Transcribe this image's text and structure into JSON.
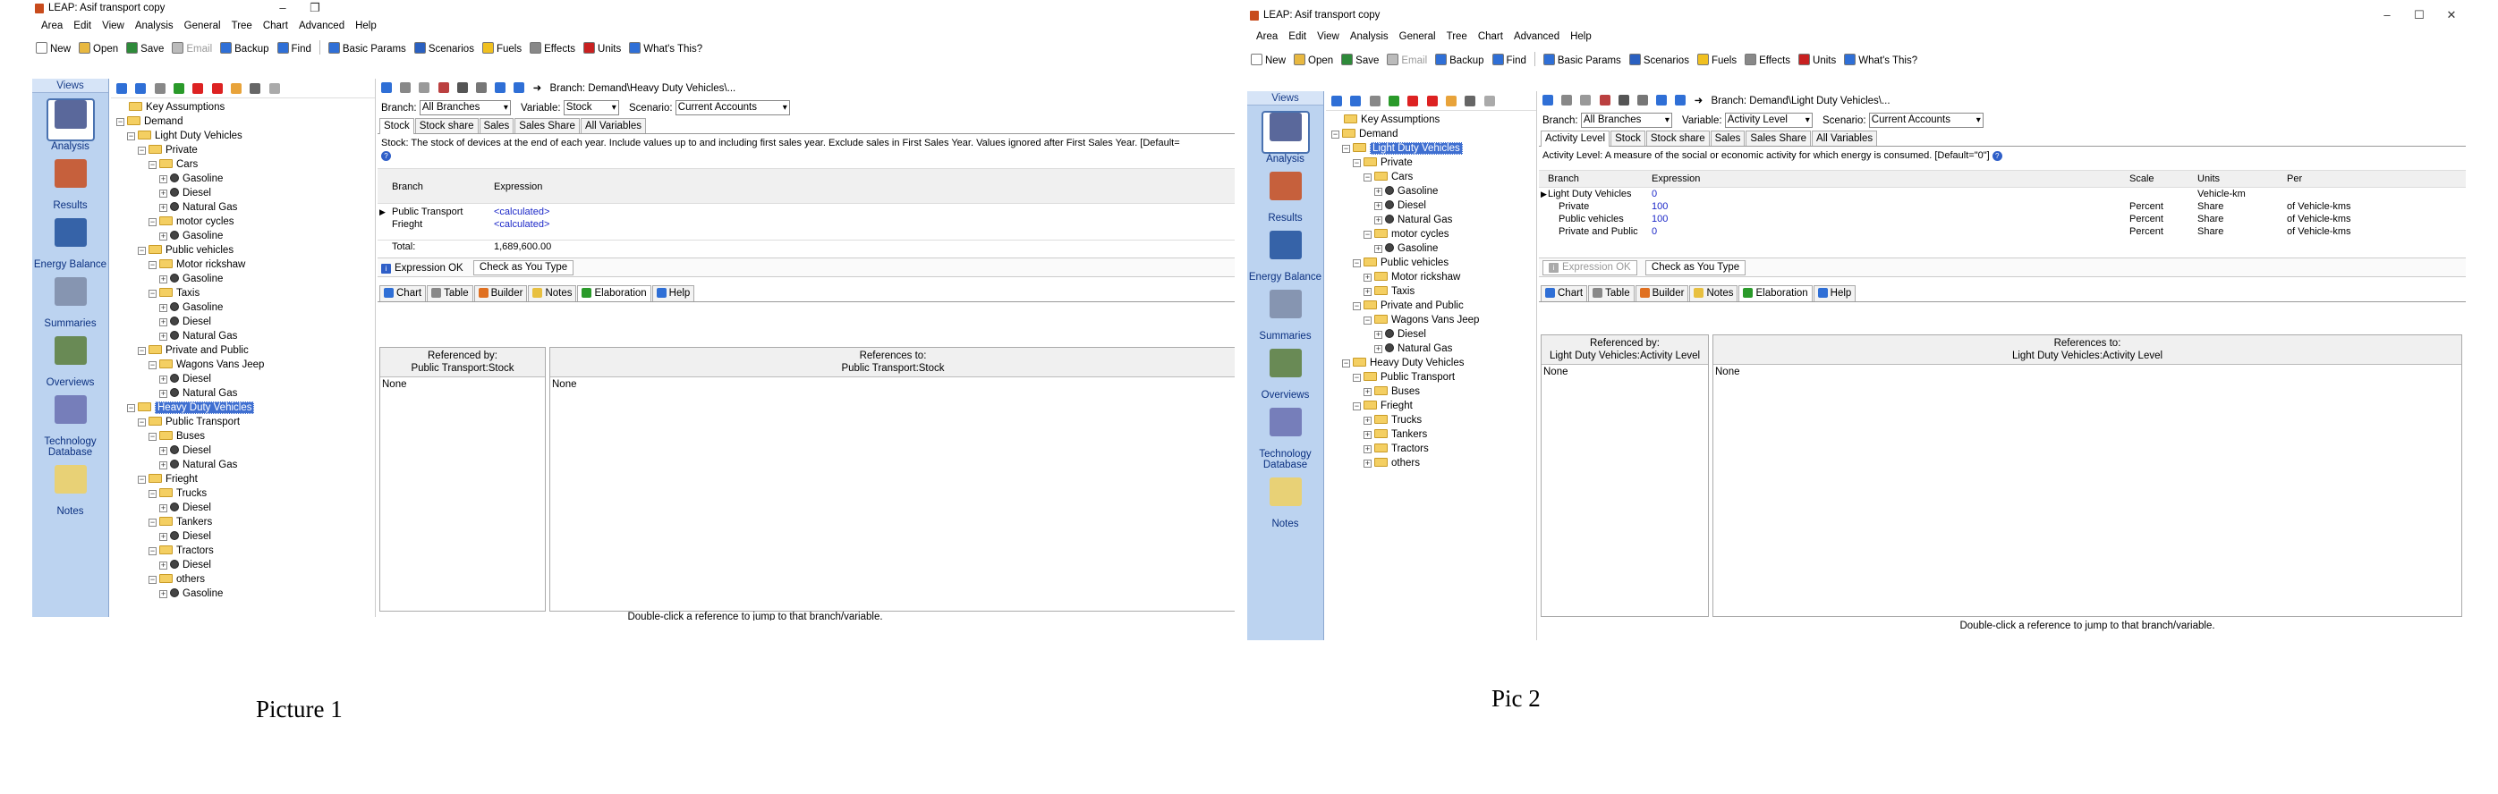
{
  "captions": {
    "left": "Picture 1",
    "right": "Pic 2"
  },
  "window": {
    "title": "LEAP: Asif transport copy",
    "menu": [
      "Area",
      "Edit",
      "View",
      "Analysis",
      "General",
      "Tree",
      "Chart",
      "Advanced",
      "Help"
    ],
    "toolbar": [
      {
        "label": "New",
        "icon": "new-icon"
      },
      {
        "label": "Open",
        "icon": "open-icon"
      },
      {
        "label": "Save",
        "icon": "save-icon"
      },
      {
        "label": "Email",
        "icon": "email-icon",
        "disabled": true
      },
      {
        "label": "Backup",
        "icon": "backup-icon"
      },
      {
        "label": "Find",
        "icon": "find-icon"
      },
      {
        "label": "Basic Params",
        "icon": "params-icon"
      },
      {
        "label": "Scenarios",
        "icon": "scenarios-icon"
      },
      {
        "label": "Fuels",
        "icon": "fuels-icon"
      },
      {
        "label": "Effects",
        "icon": "effects-icon"
      },
      {
        "label": "Units",
        "icon": "units-icon"
      },
      {
        "label": "What's This?",
        "icon": "whats-this-icon"
      }
    ],
    "views": {
      "header": "Views",
      "items": [
        "Analysis",
        "Results",
        "Energy Balance",
        "Summaries",
        "Overviews",
        "Technology Database",
        "Notes"
      ]
    },
    "colors": {
      "selection": "#3f6fd1",
      "views_panel": "#bcd3f0",
      "link": "#1c28c8"
    }
  },
  "shot1": {
    "tree": [
      {
        "label": "Key Assumptions",
        "level": 0,
        "kind": "folder"
      },
      {
        "label": "Demand",
        "level": 0,
        "kind": "folder",
        "exp": "-"
      },
      {
        "label": "Light Duty Vehicles",
        "level": 1,
        "kind": "folder",
        "exp": "-"
      },
      {
        "label": "Private",
        "level": 2,
        "kind": "folder",
        "exp": "-"
      },
      {
        "label": "Cars",
        "level": 3,
        "kind": "folder",
        "exp": "-"
      },
      {
        "label": "Gasoline",
        "level": 4,
        "kind": "fuel",
        "exp": "+"
      },
      {
        "label": "Diesel",
        "level": 4,
        "kind": "fuel",
        "exp": "+"
      },
      {
        "label": "Natural Gas",
        "level": 4,
        "kind": "fuel",
        "exp": "+"
      },
      {
        "label": "motor cycles",
        "level": 3,
        "kind": "folder",
        "exp": "-"
      },
      {
        "label": "Gasoline",
        "level": 4,
        "kind": "fuel",
        "exp": "+"
      },
      {
        "label": "Public vehicles",
        "level": 2,
        "kind": "folder",
        "exp": "-"
      },
      {
        "label": "Motor rickshaw",
        "level": 3,
        "kind": "folder",
        "exp": "-"
      },
      {
        "label": "Gasoline",
        "level": 4,
        "kind": "fuel",
        "exp": "+"
      },
      {
        "label": "Taxis",
        "level": 3,
        "kind": "folder",
        "exp": "-"
      },
      {
        "label": "Gasoline",
        "level": 4,
        "kind": "fuel",
        "exp": "+"
      },
      {
        "label": "Diesel",
        "level": 4,
        "kind": "fuel",
        "exp": "+"
      },
      {
        "label": "Natural Gas",
        "level": 4,
        "kind": "fuel",
        "exp": "+"
      },
      {
        "label": "Private and Public",
        "level": 2,
        "kind": "folder",
        "exp": "-"
      },
      {
        "label": "Wagons Vans Jeep",
        "level": 3,
        "kind": "folder",
        "exp": "-"
      },
      {
        "label": "Diesel",
        "level": 4,
        "kind": "fuel",
        "exp": "+"
      },
      {
        "label": "Natural Gas",
        "level": 4,
        "kind": "fuel",
        "exp": "+"
      },
      {
        "label": "Heavy Duty Vehicles",
        "level": 1,
        "kind": "folder",
        "exp": "-",
        "selected": true
      },
      {
        "label": "Public Transport",
        "level": 2,
        "kind": "folder",
        "exp": "-"
      },
      {
        "label": "Buses",
        "level": 3,
        "kind": "folder",
        "exp": "-"
      },
      {
        "label": "Diesel",
        "level": 4,
        "kind": "fuel",
        "exp": "+"
      },
      {
        "label": "Natural Gas",
        "level": 4,
        "kind": "fuel",
        "exp": "+"
      },
      {
        "label": "Frieght",
        "level": 2,
        "kind": "folder",
        "exp": "-"
      },
      {
        "label": "Trucks",
        "level": 3,
        "kind": "folder",
        "exp": "-"
      },
      {
        "label": "Diesel",
        "level": 4,
        "kind": "fuel",
        "exp": "+"
      },
      {
        "label": "Tankers",
        "level": 3,
        "kind": "folder",
        "exp": "-"
      },
      {
        "label": "Diesel",
        "level": 4,
        "kind": "fuel",
        "exp": "+"
      },
      {
        "label": "Tractors",
        "level": 3,
        "kind": "folder",
        "exp": "-"
      },
      {
        "label": "Diesel",
        "level": 4,
        "kind": "fuel",
        "exp": "+"
      },
      {
        "label": "others",
        "level": 3,
        "kind": "folder",
        "exp": "-"
      },
      {
        "label": "Gasoline",
        "level": 4,
        "kind": "fuel",
        "exp": "+"
      }
    ],
    "breadcrumb": "Branch: Demand\\Heavy Duty Vehicles\\...",
    "branch_label": "Branch:",
    "branch_value": "All Branches",
    "variable_label": "Variable:",
    "variable_value": "Stock",
    "scenario_label": "Scenario:",
    "scenario_value": "Current Accounts",
    "tabs": [
      "Stock",
      "Stock share",
      "Sales",
      "Sales Share",
      "All Variables"
    ],
    "active_tab": 0,
    "description": "Stock: The stock of devices at the end of each year.  Include values up to and including first sales year.  Exclude sales in First Sales Year.  Values ignored after First Sales Year. [Default=",
    "grid_headers": [
      "Branch",
      "Expression"
    ],
    "rows": [
      {
        "branch": "Public Transport",
        "expr": "<calculated>"
      },
      {
        "branch": "Frieght",
        "expr": "<calculated>"
      }
    ],
    "total_label": "Total:",
    "total_value": "1,689,600.00",
    "status_ok": "Expression OK",
    "check_label": "Check as You Type",
    "bottom_tabs": [
      "Chart",
      "Table",
      "Builder",
      "Notes",
      "Elaboration",
      "Help"
    ],
    "active_bottom_tab": 4,
    "ref_by_title": "Referenced by:",
    "ref_by_sub": "Public Transport:Stock",
    "ref_to_title": "References to:",
    "ref_to_sub": "Public Transport:Stock",
    "ref_by_body": "None",
    "ref_to_body": "None",
    "footer": "Double-click a reference to jump to that branch/variable."
  },
  "shot2": {
    "tree": [
      {
        "label": "Key Assumptions",
        "level": 0,
        "kind": "folder"
      },
      {
        "label": "Demand",
        "level": 0,
        "kind": "folder",
        "exp": "-"
      },
      {
        "label": "Light Duty Vehicles",
        "level": 1,
        "kind": "folder",
        "exp": "-",
        "selected": true
      },
      {
        "label": "Private",
        "level": 2,
        "kind": "folder",
        "exp": "-"
      },
      {
        "label": "Cars",
        "level": 3,
        "kind": "folder",
        "exp": "-"
      },
      {
        "label": "Gasoline",
        "level": 4,
        "kind": "fuel",
        "exp": "+"
      },
      {
        "label": "Diesel",
        "level": 4,
        "kind": "fuel",
        "exp": "+"
      },
      {
        "label": "Natural Gas",
        "level": 4,
        "kind": "fuel",
        "exp": "+"
      },
      {
        "label": "motor cycles",
        "level": 3,
        "kind": "folder",
        "exp": "-"
      },
      {
        "label": "Gasoline",
        "level": 4,
        "kind": "fuel",
        "exp": "+"
      },
      {
        "label": "Public vehicles",
        "level": 2,
        "kind": "folder",
        "exp": "-"
      },
      {
        "label": "Motor rickshaw",
        "level": 3,
        "kind": "folder",
        "exp": "+"
      },
      {
        "label": "Taxis",
        "level": 3,
        "kind": "folder",
        "exp": "+"
      },
      {
        "label": "Private and Public",
        "level": 2,
        "kind": "folder",
        "exp": "-"
      },
      {
        "label": "Wagons Vans Jeep",
        "level": 3,
        "kind": "folder",
        "exp": "-"
      },
      {
        "label": "Diesel",
        "level": 4,
        "kind": "fuel",
        "exp": "+"
      },
      {
        "label": "Natural Gas",
        "level": 4,
        "kind": "fuel",
        "exp": "+"
      },
      {
        "label": "Heavy Duty Vehicles",
        "level": 1,
        "kind": "folder",
        "exp": "-"
      },
      {
        "label": "Public Transport",
        "level": 2,
        "kind": "folder",
        "exp": "-"
      },
      {
        "label": "Buses",
        "level": 3,
        "kind": "folder",
        "exp": "+"
      },
      {
        "label": "Frieght",
        "level": 2,
        "kind": "folder",
        "exp": "-"
      },
      {
        "label": "Trucks",
        "level": 3,
        "kind": "folder",
        "exp": "+"
      },
      {
        "label": "Tankers",
        "level": 3,
        "kind": "folder",
        "exp": "+"
      },
      {
        "label": "Tractors",
        "level": 3,
        "kind": "folder",
        "exp": "+"
      },
      {
        "label": "others",
        "level": 3,
        "kind": "folder",
        "exp": "+"
      }
    ],
    "breadcrumb": "Branch: Demand\\Light Duty Vehicles\\...",
    "branch_label": "Branch:",
    "branch_value": "All Branches",
    "variable_label": "Variable:",
    "variable_value": "Activity Level",
    "scenario_label": "Scenario:",
    "scenario_value": "Current Accounts",
    "tabs": [
      "Activity Level",
      "Stock",
      "Stock share",
      "Sales",
      "Sales Share",
      "All Variables"
    ],
    "active_tab": 0,
    "description": "Activity Level: A measure of the social or economic activity for which energy is consumed. [Default=\"0\"]",
    "grid_headers": [
      "Branch",
      "Expression",
      "Scale",
      "Units",
      "Per"
    ],
    "rows": [
      {
        "branch": "Light Duty Vehicles",
        "expr": "0",
        "scale": "",
        "units": "Vehicle-km",
        "per": ""
      },
      {
        "branch": "Private",
        "expr": "100",
        "scale": "Percent",
        "units": "Share",
        "per": "of Vehicle-kms"
      },
      {
        "branch": "Public vehicles",
        "expr": "100",
        "scale": "Percent",
        "units": "Share",
        "per": "of Vehicle-kms"
      },
      {
        "branch": "Private and Public",
        "expr": "0",
        "scale": "Percent",
        "units": "Share",
        "per": "of Vehicle-kms"
      }
    ],
    "status_ok": "Expression OK",
    "check_label": "Check as You Type",
    "bottom_tabs": [
      "Chart",
      "Table",
      "Builder",
      "Notes",
      "Elaboration",
      "Help"
    ],
    "active_bottom_tab": 4,
    "ref_by_title": "Referenced by:",
    "ref_by_sub": "Light Duty Vehicles:Activity Level",
    "ref_to_title": "References to:",
    "ref_to_sub": "Light Duty Vehicles:Activity Level",
    "ref_by_body": "None",
    "ref_to_body": "None",
    "footer": "Double-click a reference to jump to that branch/variable."
  }
}
